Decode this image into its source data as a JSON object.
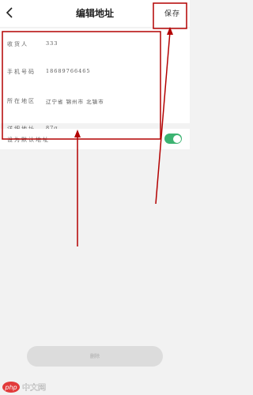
{
  "header": {
    "title": "编辑地址",
    "save_label": "保存"
  },
  "form": {
    "rows": [
      {
        "label": "收货人",
        "value": "333"
      },
      {
        "label": "手机号码",
        "value": "18689766465"
      },
      {
        "label": "所在地区",
        "value": "辽宁省 锦州市 北镇市"
      },
      {
        "label": "详细地址",
        "value": "87g"
      }
    ]
  },
  "default_address": {
    "label": "设为默认地址",
    "enabled": true
  },
  "bottom_button": {
    "label": "删除"
  },
  "watermark": {
    "text": "php 中文网"
  },
  "colors": {
    "annotation": "#b30000",
    "toggle_on": "#3cb371"
  }
}
